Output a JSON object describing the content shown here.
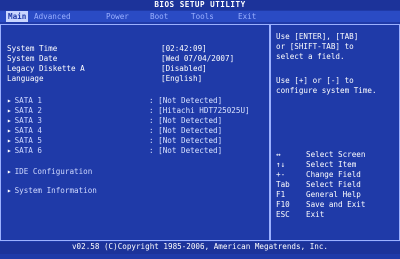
{
  "title": "BIOS SETUP UTILITY",
  "menu": [
    "Main",
    "Advanced",
    "Power",
    "Boot",
    "Tools",
    "Exit"
  ],
  "main": {
    "system_time_label": "System Time",
    "system_time_value": "[02:42:09]",
    "system_date_label": "System Date",
    "system_date_value": "[Wed 07/04/2007]",
    "legacy_label": "Legacy Diskette A",
    "legacy_value": "[Disabled]",
    "language_label": "Language",
    "language_value": "[English]",
    "sata": [
      {
        "label": "SATA 1",
        "value": "[Not Detected]"
      },
      {
        "label": "SATA 2",
        "value": "[Hitachi HDT725025U]"
      },
      {
        "label": "SATA 3",
        "value": "[Not Detected]"
      },
      {
        "label": "SATA 4",
        "value": "[Not Detected]"
      },
      {
        "label": "SATA 5",
        "value": "[Not Detected]"
      },
      {
        "label": "SATA 6",
        "value": "[Not Detected]"
      }
    ],
    "ide_config": "IDE Configuration",
    "system_info": "System Information"
  },
  "help": {
    "text1": "Use [ENTER], [TAB]\nor [SHIFT-TAB] to\nselect a field.",
    "text2": "Use [+] or [-] to\nconfigure system Time."
  },
  "legend": [
    {
      "key": "↔",
      "desc": "Select Screen"
    },
    {
      "key": "↑↓",
      "desc": "Select Item"
    },
    {
      "key": "+-",
      "desc": "Change Field"
    },
    {
      "key": "Tab",
      "desc": "Select Field"
    },
    {
      "key": "F1",
      "desc": "General Help"
    },
    {
      "key": "F10",
      "desc": "Save and Exit"
    },
    {
      "key": "ESC",
      "desc": "Exit"
    }
  ],
  "footer": "v02.58 (C)Copyright 1985-2006, American Megatrends, Inc."
}
